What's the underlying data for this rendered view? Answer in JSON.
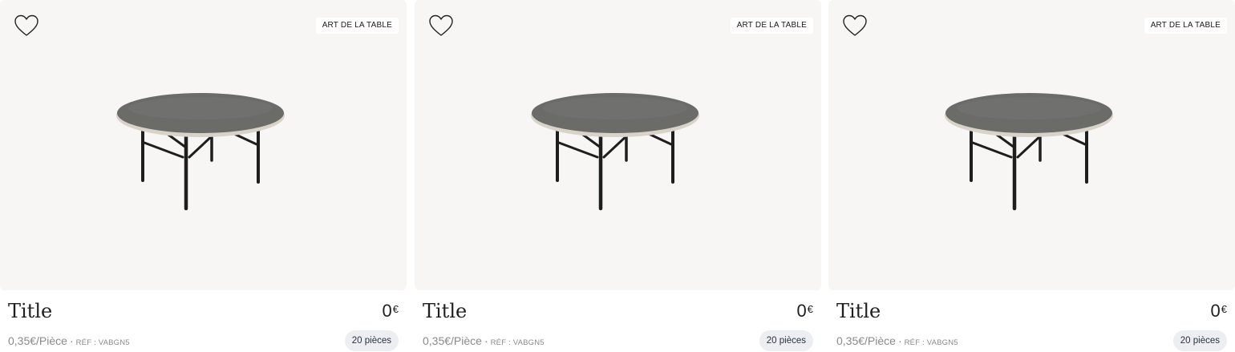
{
  "products": [
    {
      "badge": "ART DE LA TABLE",
      "title": "Title",
      "price": "0",
      "currency": "€",
      "unit_price": "0,35€/Pièce",
      "separator": "·",
      "ref": "RÉF : VABGN5",
      "quantity": "20 pièces",
      "favorite_icon": "heart-icon"
    },
    {
      "badge": "ART DE LA TABLE",
      "title": "Title",
      "price": "0",
      "currency": "€",
      "unit_price": "0,35€/Pièce",
      "separator": "·",
      "ref": "RÉF : VABGN5",
      "quantity": "20 pièces",
      "favorite_icon": "heart-icon"
    },
    {
      "badge": "ART DE LA TABLE",
      "title": "Title",
      "price": "0",
      "currency": "€",
      "unit_price": "0,35€/Pièce",
      "separator": "·",
      "ref": "RÉF : VABGN5",
      "quantity": "20 pièces",
      "favorite_icon": "heart-icon"
    }
  ],
  "colors": {
    "card_background": "#f7f6f4",
    "table_top": "#6b6b68",
    "table_legs": "#1e1e1e",
    "quantity_pill": "#eceef2"
  }
}
